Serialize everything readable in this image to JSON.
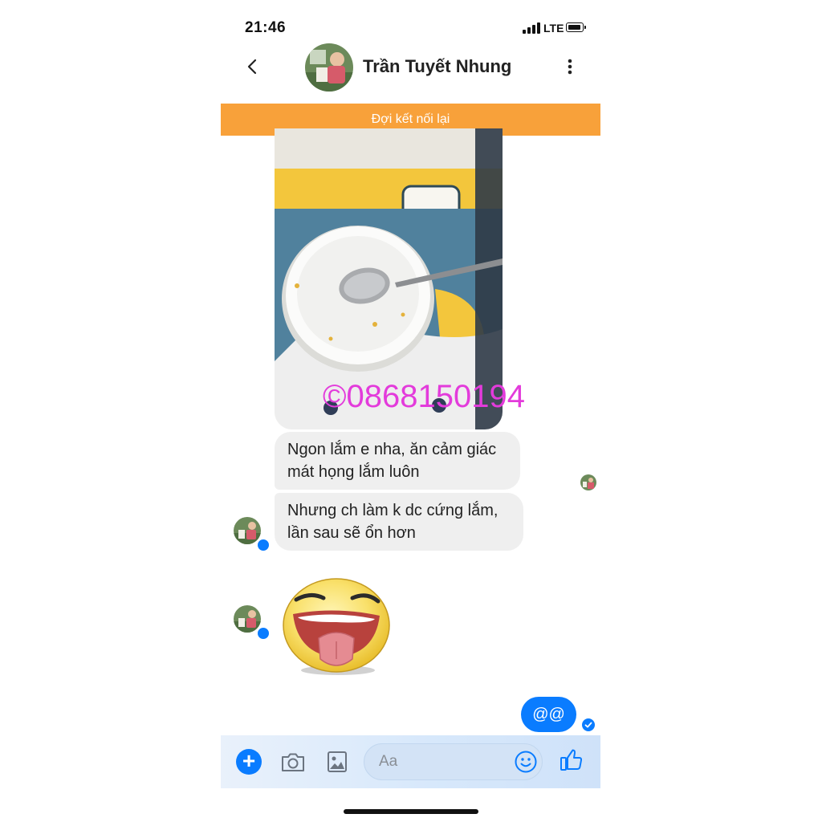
{
  "status_bar": {
    "time": "21:46",
    "network": "LTE"
  },
  "header": {
    "contact_name": "Trần Tuyết Nhung"
  },
  "banner": {
    "text": "Đợi kết nối lại"
  },
  "photo": {
    "watermark": "©0868150194"
  },
  "messages": [
    {
      "direction": "incoming",
      "text": "Ngon lắm e nha, ăn cảm giác mát họng lắm luôn"
    },
    {
      "direction": "incoming",
      "text": "Nhưng ch làm k dc cứng lắm, lần sau sẽ ổn hơn"
    },
    {
      "direction": "incoming",
      "sticker": "tongue-out-smiley-sticker"
    },
    {
      "direction": "outgoing",
      "text": "@@"
    }
  ],
  "composer": {
    "placeholder": "Aa"
  },
  "colors": {
    "accent": "#0a7cff",
    "banner": "#f8a13a",
    "incoming_bubble": "#efefef"
  }
}
